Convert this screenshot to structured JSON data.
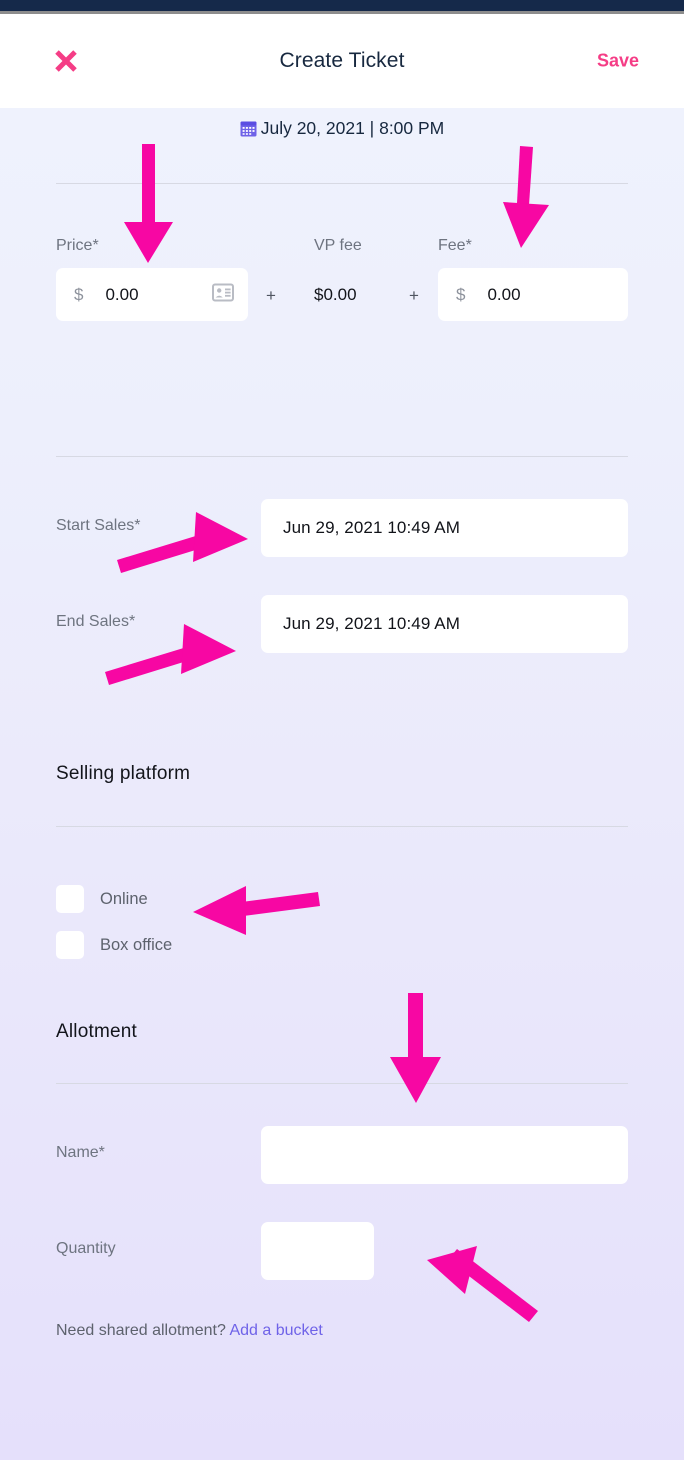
{
  "window": {
    "statusbar_color": "#15294a",
    "background_top": "#eff2fd",
    "background_bottom": "#e5e0fb"
  },
  "header": {
    "close_icon": "close-x-icon",
    "title": "Create Ticket",
    "save_label": "Save",
    "accent_color": "#f53d86"
  },
  "event": {
    "calendar_icon": "calendar-icon",
    "datetime_text": "July 20, 2021  |  8:00 PM"
  },
  "pricing": {
    "price": {
      "label": "Price*",
      "currency_symbol": "$",
      "value": "0.00",
      "trailing_icon": "id-card-icon"
    },
    "operator_1": "+",
    "vp_fee": {
      "label": "VP fee",
      "value": "$0.00"
    },
    "operator_2": "+",
    "fee": {
      "label": "Fee*",
      "currency_symbol": "$",
      "value": "0.00"
    }
  },
  "sales_window": {
    "start": {
      "label": "Start Sales*",
      "value": "Jun 29, 2021 10:49 AM"
    },
    "end": {
      "label": "End Sales*",
      "value": "Jun 29, 2021 10:49 AM"
    }
  },
  "selling_platform": {
    "title": "Selling platform",
    "options": [
      {
        "label": "Online",
        "checked": false
      },
      {
        "label": "Box office",
        "checked": false
      }
    ]
  },
  "allotment": {
    "title": "Allotment",
    "name": {
      "label": "Name*",
      "value": "",
      "placeholder": ""
    },
    "quantity": {
      "label": "Quantity",
      "value": "",
      "placeholder": ""
    },
    "shared_prompt": "Need shared allotment?",
    "shared_link": "Add a bucket",
    "link_color": "#6f63e8"
  },
  "annotations": {
    "color": "#f707a3",
    "arrows": [
      {
        "name": "arrow-to-price-field",
        "direction": "down"
      },
      {
        "name": "arrow-to-fee-field",
        "direction": "down"
      },
      {
        "name": "arrow-to-start-sales-field",
        "direction": "right"
      },
      {
        "name": "arrow-to-end-sales-field",
        "direction": "right"
      },
      {
        "name": "arrow-to-online-checkbox",
        "direction": "left"
      },
      {
        "name": "arrow-to-allotment-name-field",
        "direction": "down"
      },
      {
        "name": "arrow-to-quantity-field",
        "direction": "up-left"
      }
    ]
  }
}
